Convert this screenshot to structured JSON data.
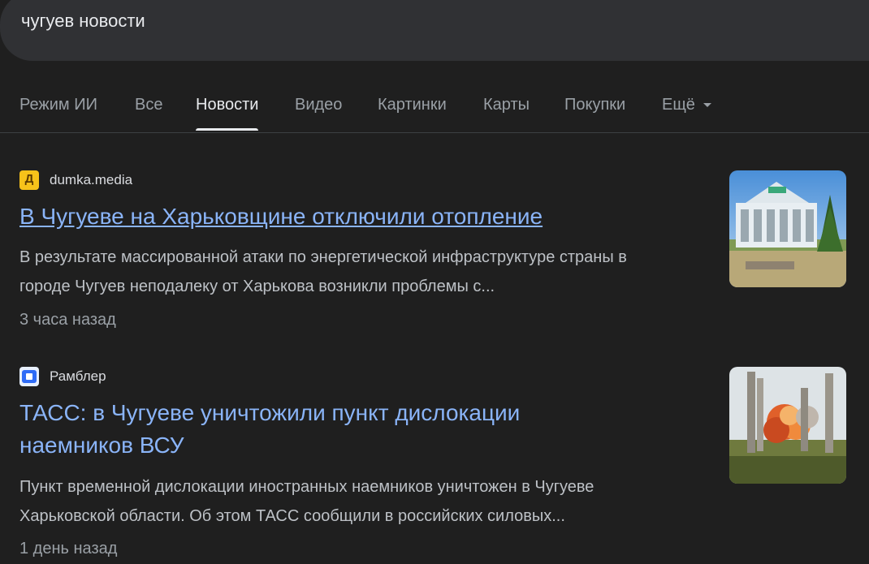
{
  "search": {
    "query": "чугуев новости"
  },
  "tabs": [
    {
      "label": "Режим ИИ"
    },
    {
      "label": "Все"
    },
    {
      "label": "Новости"
    },
    {
      "label": "Видео"
    },
    {
      "label": "Картинки"
    },
    {
      "label": "Карты"
    },
    {
      "label": "Покупки"
    },
    {
      "label": "Ещё"
    }
  ],
  "active_tab": "Новости",
  "results": [
    {
      "source": "dumka.media",
      "favicon_letter": "Д",
      "headline": "В Чугуеве на Харьковщине отключили отопление",
      "snippet_line1": "В результате массированной атаки по энергетической инфраструктуре страны в",
      "snippet_line2": "городе Чугуев неподалеку от Харькова возникли проблемы с...",
      "time": "3 часа назад"
    },
    {
      "source": "Рамблер",
      "headline_line1": "ТАСС: в Чугуеве уничтожили пункт дислокации",
      "headline_line2": "наемников ВСУ",
      "snippet_line1": "Пункт временной дислокации иностранных наемников уничтожен в Чугуеве",
      "snippet_line2": "Харьковской области. Об этом ТАСС сообщили в российских силовых...",
      "time": "1 день назад"
    }
  ],
  "colors": {
    "background": "#1f1f1f",
    "link": "#8ab4f8",
    "search_bar": "#303134"
  }
}
